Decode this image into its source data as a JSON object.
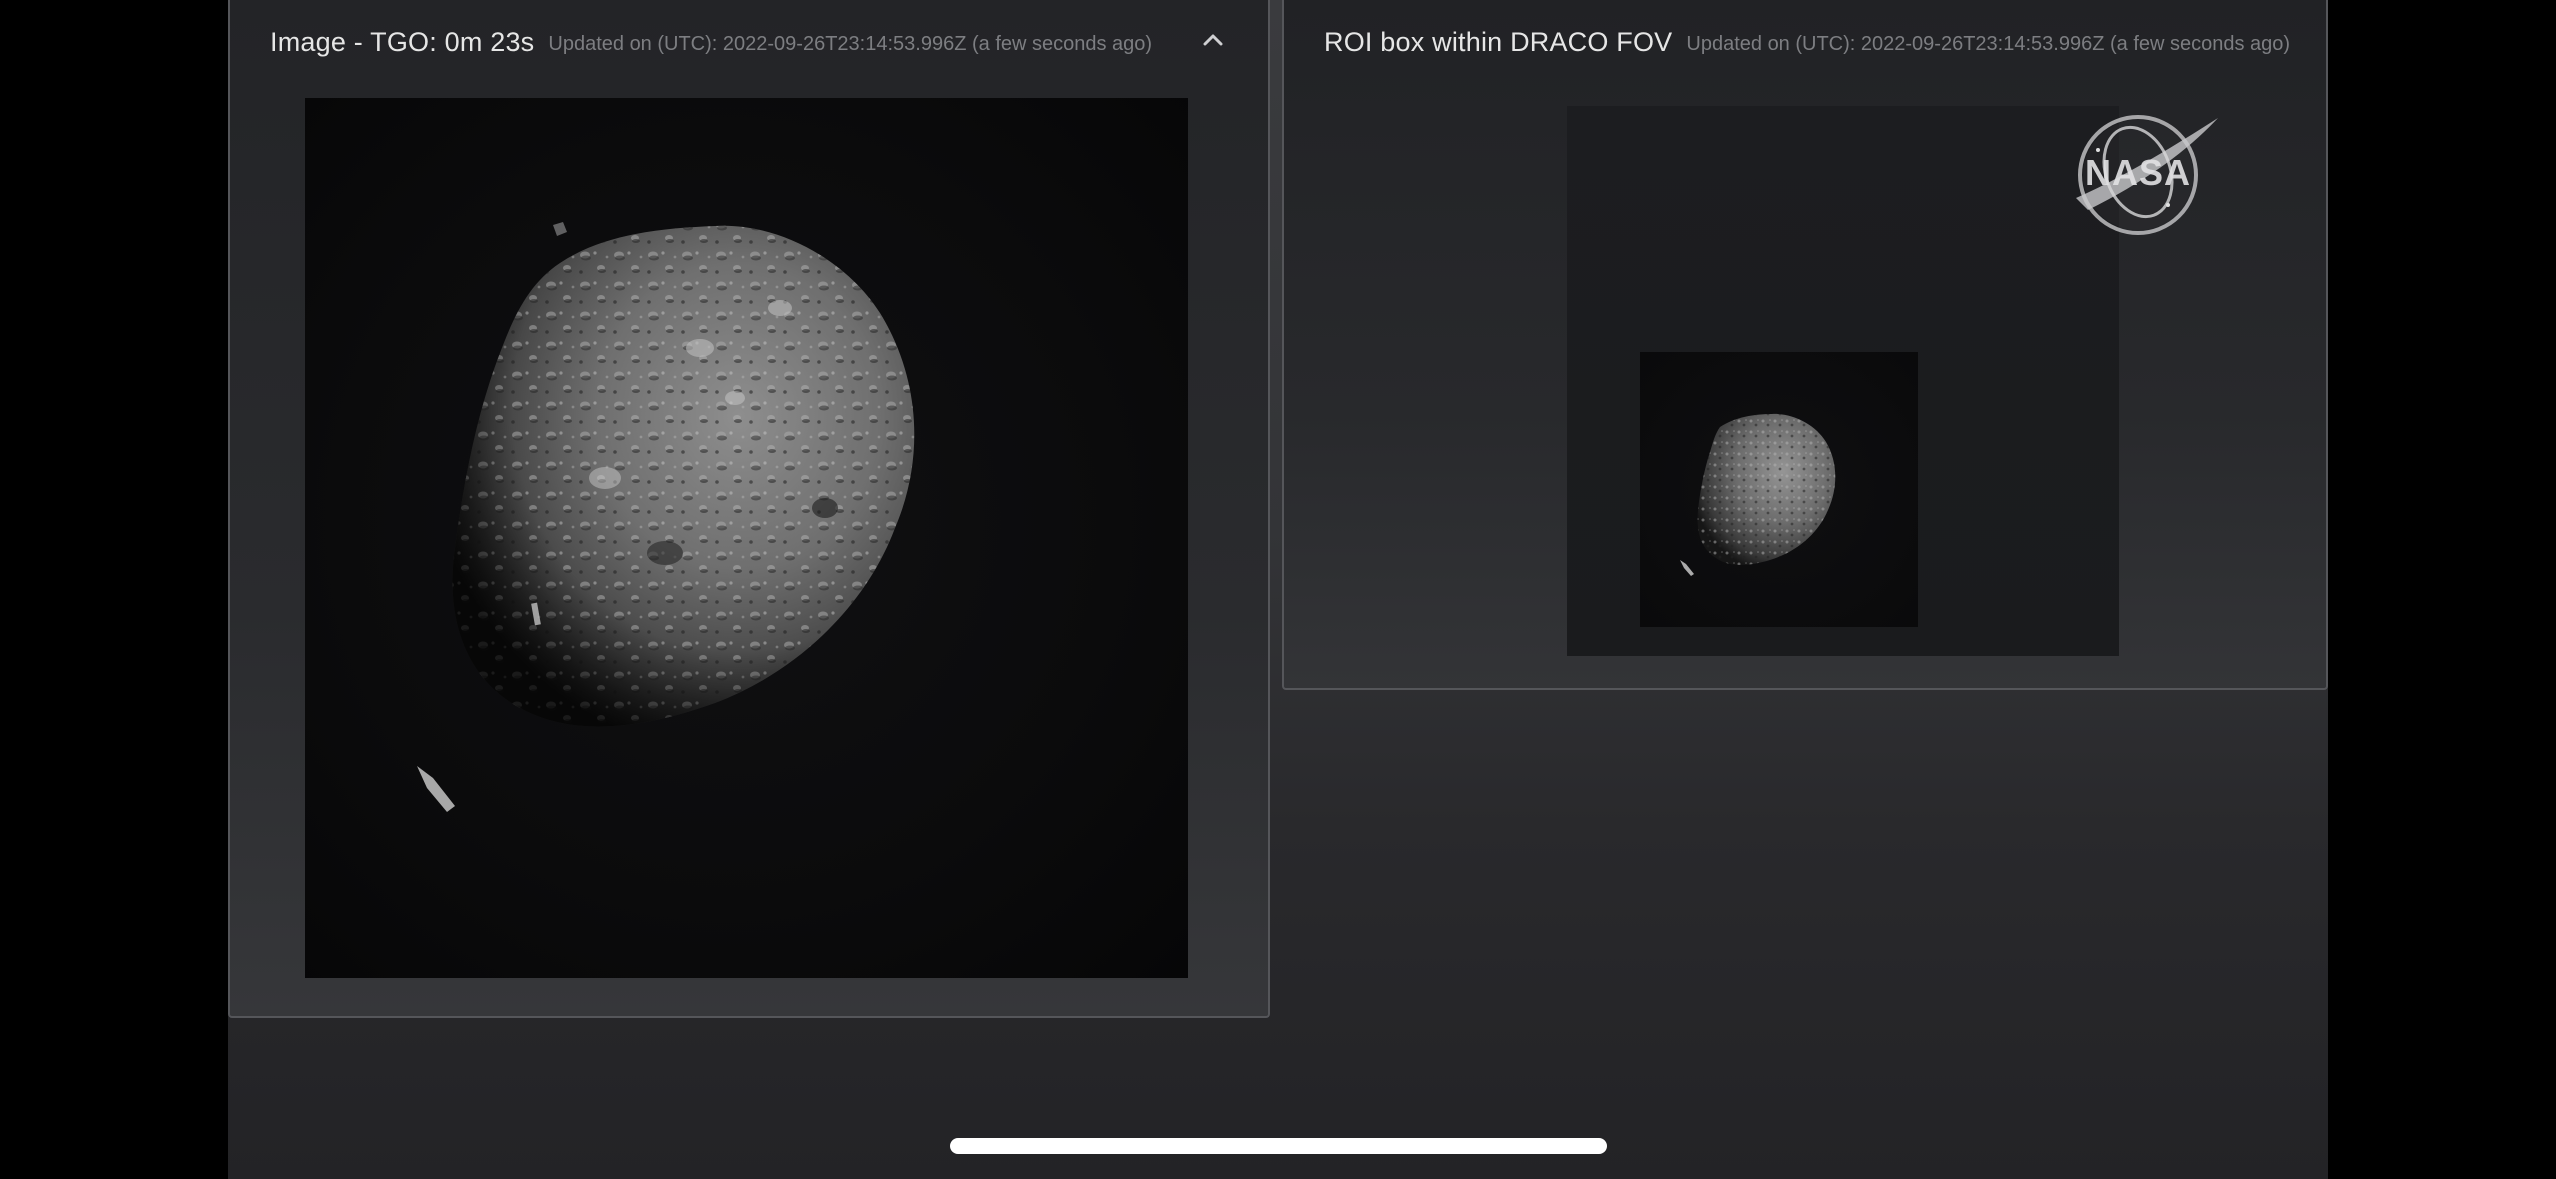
{
  "left_panel": {
    "title": "Image - TGO: 0m 23s",
    "updated": "Updated on (UTC): 2022-09-26T23:14:53.996Z (a few seconds ago)",
    "collapse_icon": "chevron-up-icon",
    "image_alt": "DRACO image of asteroid Dimorphos"
  },
  "right_panel": {
    "title": "ROI box within DRACO FOV",
    "updated": "Updated on (UTC): 2022-09-26T23:14:53.996Z (a few seconds ago)",
    "image_alt": "Region of interest box showing asteroid within DRACO field of view"
  },
  "overlay": {
    "logo": "NASA",
    "logo_icon": "nasa-meatball-icon"
  },
  "colors": {
    "background": "#000000",
    "panel": "#2a2b2e",
    "title_text": "#e6e6e6",
    "subtitle_text": "#7d7e82",
    "home_indicator": "#ffffff"
  }
}
